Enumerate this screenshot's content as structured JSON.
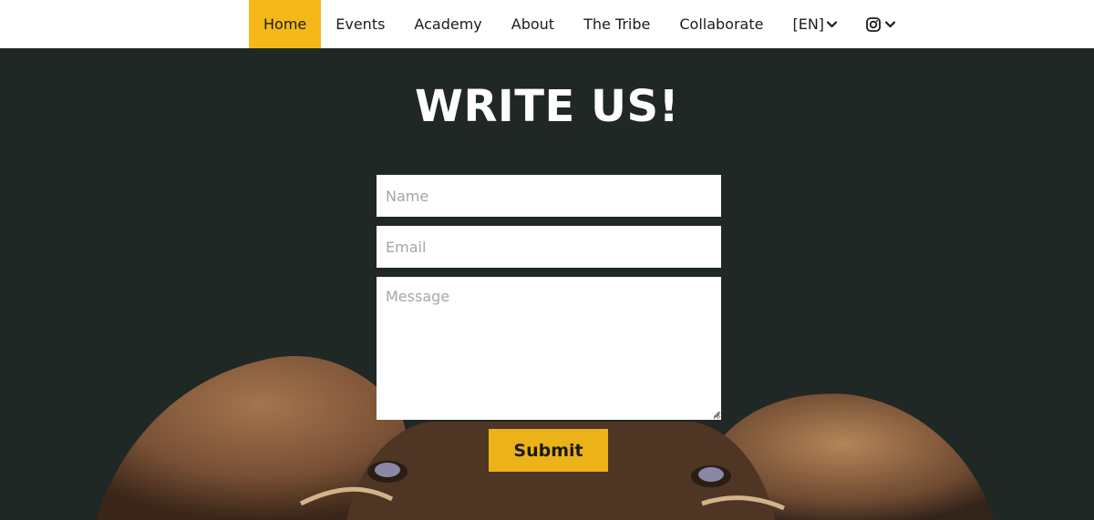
{
  "nav": {
    "items": [
      {
        "label": "Home",
        "active": true
      },
      {
        "label": "Events"
      },
      {
        "label": "Academy"
      },
      {
        "label": "About"
      },
      {
        "label": "The Tribe"
      },
      {
        "label": "Collaborate"
      },
      {
        "label": "[EN]"
      }
    ],
    "instagram_icon": "instagram-icon"
  },
  "hero": {
    "title": "WRITE US!"
  },
  "form": {
    "name_placeholder": "Name",
    "email_placeholder": "Email",
    "message_placeholder": "Message",
    "submit_label": "Submit"
  },
  "colors": {
    "accent": "#f4b919",
    "hero_bg": "#1f2825",
    "submit_bg": "#ecb318"
  }
}
